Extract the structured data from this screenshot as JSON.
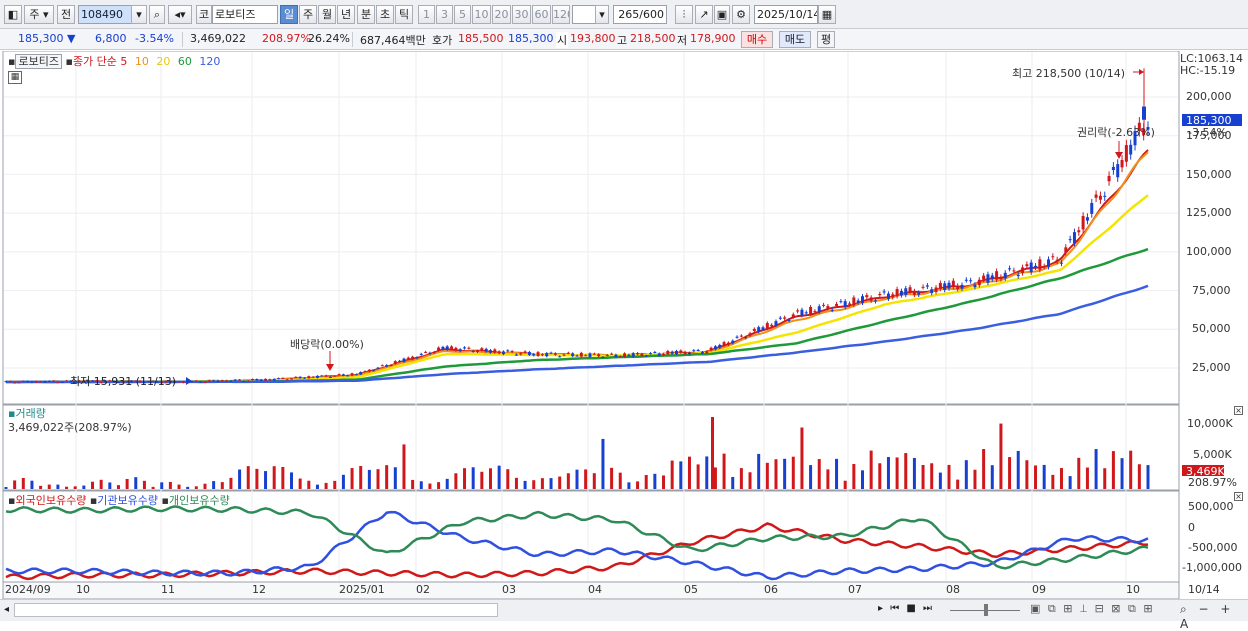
{
  "toolbar": {
    "mode": "주",
    "prev": "전",
    "code": "108490",
    "market": "코",
    "name": "로보티즈",
    "periods": [
      "일",
      "주",
      "월",
      "년",
      "분",
      "초",
      "틱"
    ],
    "selected_period": "일",
    "intervals": [
      "1",
      "3",
      "5",
      "10",
      "20",
      "30",
      "60",
      "120"
    ],
    "count": "265",
    "count_max": "/600",
    "date": "2025/10/14"
  },
  "info": {
    "price": "185,300",
    "change": "6,800",
    "rate": "-3.54%",
    "volume": "3,469,022",
    "vol_rate": "208.97%",
    "turnover": "26.24%",
    "amount": "687,464백만",
    "ask_label": "호가",
    "ask1": "185,500",
    "ask2": "185,300",
    "open_label": "시",
    "open": "193,800",
    "high_label": "고",
    "high": "218,500",
    "low_label": "저",
    "low": "178,900",
    "buy": "매수",
    "sell": "매도",
    "avg": "평"
  },
  "chart": {
    "legend_name": "로보티즈",
    "legend_series": "종가 단순",
    "ma_labels": [
      "5",
      "10",
      "20",
      "60",
      "120"
    ],
    "lc": "LC:1063.14",
    "hc": "HC:-15.19",
    "high_note": "최고 218,500 (10/14)",
    "low_note": "최저 15,931 (11/13)",
    "div_note": "배당락(0.00%)",
    "rights_note": "권리락(-2.63%)",
    "price_tag": "185,300",
    "rate_tag": "-3.54%",
    "y_labels": [
      "200,000",
      "175,000",
      "150,000",
      "125,000",
      "100,000",
      "75,000",
      "50,000",
      "25,000"
    ],
    "vol_title": "거래량",
    "vol_sub": "3,469,022주(208.97%)",
    "vol_y": [
      "10,000K",
      "5,000K"
    ],
    "vol_tag": "3,469K",
    "vol_rate_tag": "208.97%",
    "hold_labels": [
      "외국인보유수량",
      "기관보유수량",
      "개인보유수량"
    ],
    "hold_y": [
      "500,000",
      "0",
      "-500,000",
      "-1,000,000"
    ],
    "x_labels": [
      "2024/09",
      "10",
      "11",
      "12",
      "2025/01",
      "02",
      "03",
      "04",
      "05",
      "06",
      "07",
      "08",
      "09",
      "10"
    ],
    "x_end": "10/14"
  },
  "colors": {
    "red": "#d0181c",
    "blue": "#1840d0",
    "ma5": "#d0181c",
    "ma10": "#f0901c",
    "ma20": "#f4e400",
    "ma60": "#1f9a3a",
    "ma120": "#3a5ee0",
    "foreign": "#d01818",
    "inst": "#3050e0",
    "indiv": "#2e8b57"
  },
  "chart_data": {
    "type": "line",
    "title": "로보티즈",
    "x": [
      "2024/09",
      "10",
      "11",
      "12",
      "2025/01",
      "02",
      "03",
      "04",
      "05",
      "06",
      "07",
      "08",
      "09",
      "10"
    ],
    "series": [
      {
        "name": "종가",
        "values": [
          15931,
          16500,
          16000,
          17500,
          21000,
          38000,
          34000,
          33000,
          36000,
          60000,
          72000,
          80000,
          95000,
          185300
        ]
      },
      {
        "name": "5",
        "values": [
          16000,
          16400,
          16200,
          17200,
          20500,
          37000,
          34000,
          33000,
          35500,
          58000,
          71000,
          79000,
          94000,
          165000
        ]
      },
      {
        "name": "10",
        "values": [
          16000,
          16300,
          16200,
          17000,
          20000,
          36000,
          34000,
          33000,
          35000,
          56000,
          70000,
          78000,
          92000,
          165000
        ]
      },
      {
        "name": "20",
        "values": [
          16000,
          16200,
          16200,
          16800,
          19000,
          34000,
          33500,
          33000,
          34500,
          48000,
          66000,
          76000,
          88000,
          137000
        ]
      },
      {
        "name": "60",
        "values": [
          16000,
          16000,
          16100,
          16300,
          17500,
          26000,
          30000,
          32000,
          34000,
          41000,
          55000,
          68000,
          83000,
          102000
        ]
      },
      {
        "name": "120",
        "values": [
          16000,
          16000,
          16000,
          16100,
          16800,
          21000,
          24000,
          26500,
          29000,
          35000,
          42000,
          50000,
          60000,
          78000
        ]
      }
    ],
    "ylim": [
      0,
      218500
    ]
  }
}
